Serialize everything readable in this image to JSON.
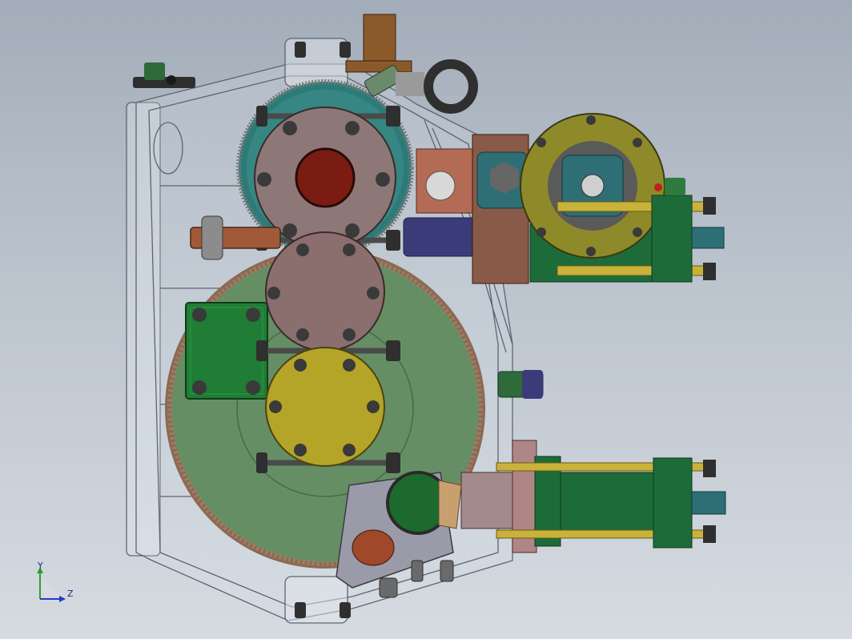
{
  "viewport": {
    "background_top": "#a3adb9",
    "background_bottom": "#d6dbe1"
  },
  "triad": {
    "y_label": "Y",
    "z_label": "Z",
    "y_color": "#2ca02c",
    "z_color": "#1f3fbf"
  },
  "model": {
    "parts": [
      "housing-frame",
      "upper-gear",
      "large-gear",
      "idler-hub",
      "lower-hub",
      "input-shaft",
      "eye-bolt",
      "breather",
      "upper-motor-flange",
      "upper-hydraulic-cylinder",
      "lower-hydraulic-cylinder",
      "green-cover-plate",
      "side-plug",
      "bevel-gear-bracket",
      "lower-valve-fittings"
    ],
    "colors": {
      "housing": "#cfd5dc",
      "gear_green": "#4f8a5a",
      "gear_teeth": "#8a6a55",
      "hub_brown": "#8b6e6e",
      "hub_yellow": "#b4a428",
      "flange_olive": "#8e8a2a",
      "cylinder_green": "#1e6b3a",
      "rod_yellow": "#c8b23a",
      "shaft_rust": "#a05a3a",
      "bolt_dark": "#3a3a3a",
      "teal": "#2d6f74",
      "navy": "#3b3b7a"
    }
  }
}
